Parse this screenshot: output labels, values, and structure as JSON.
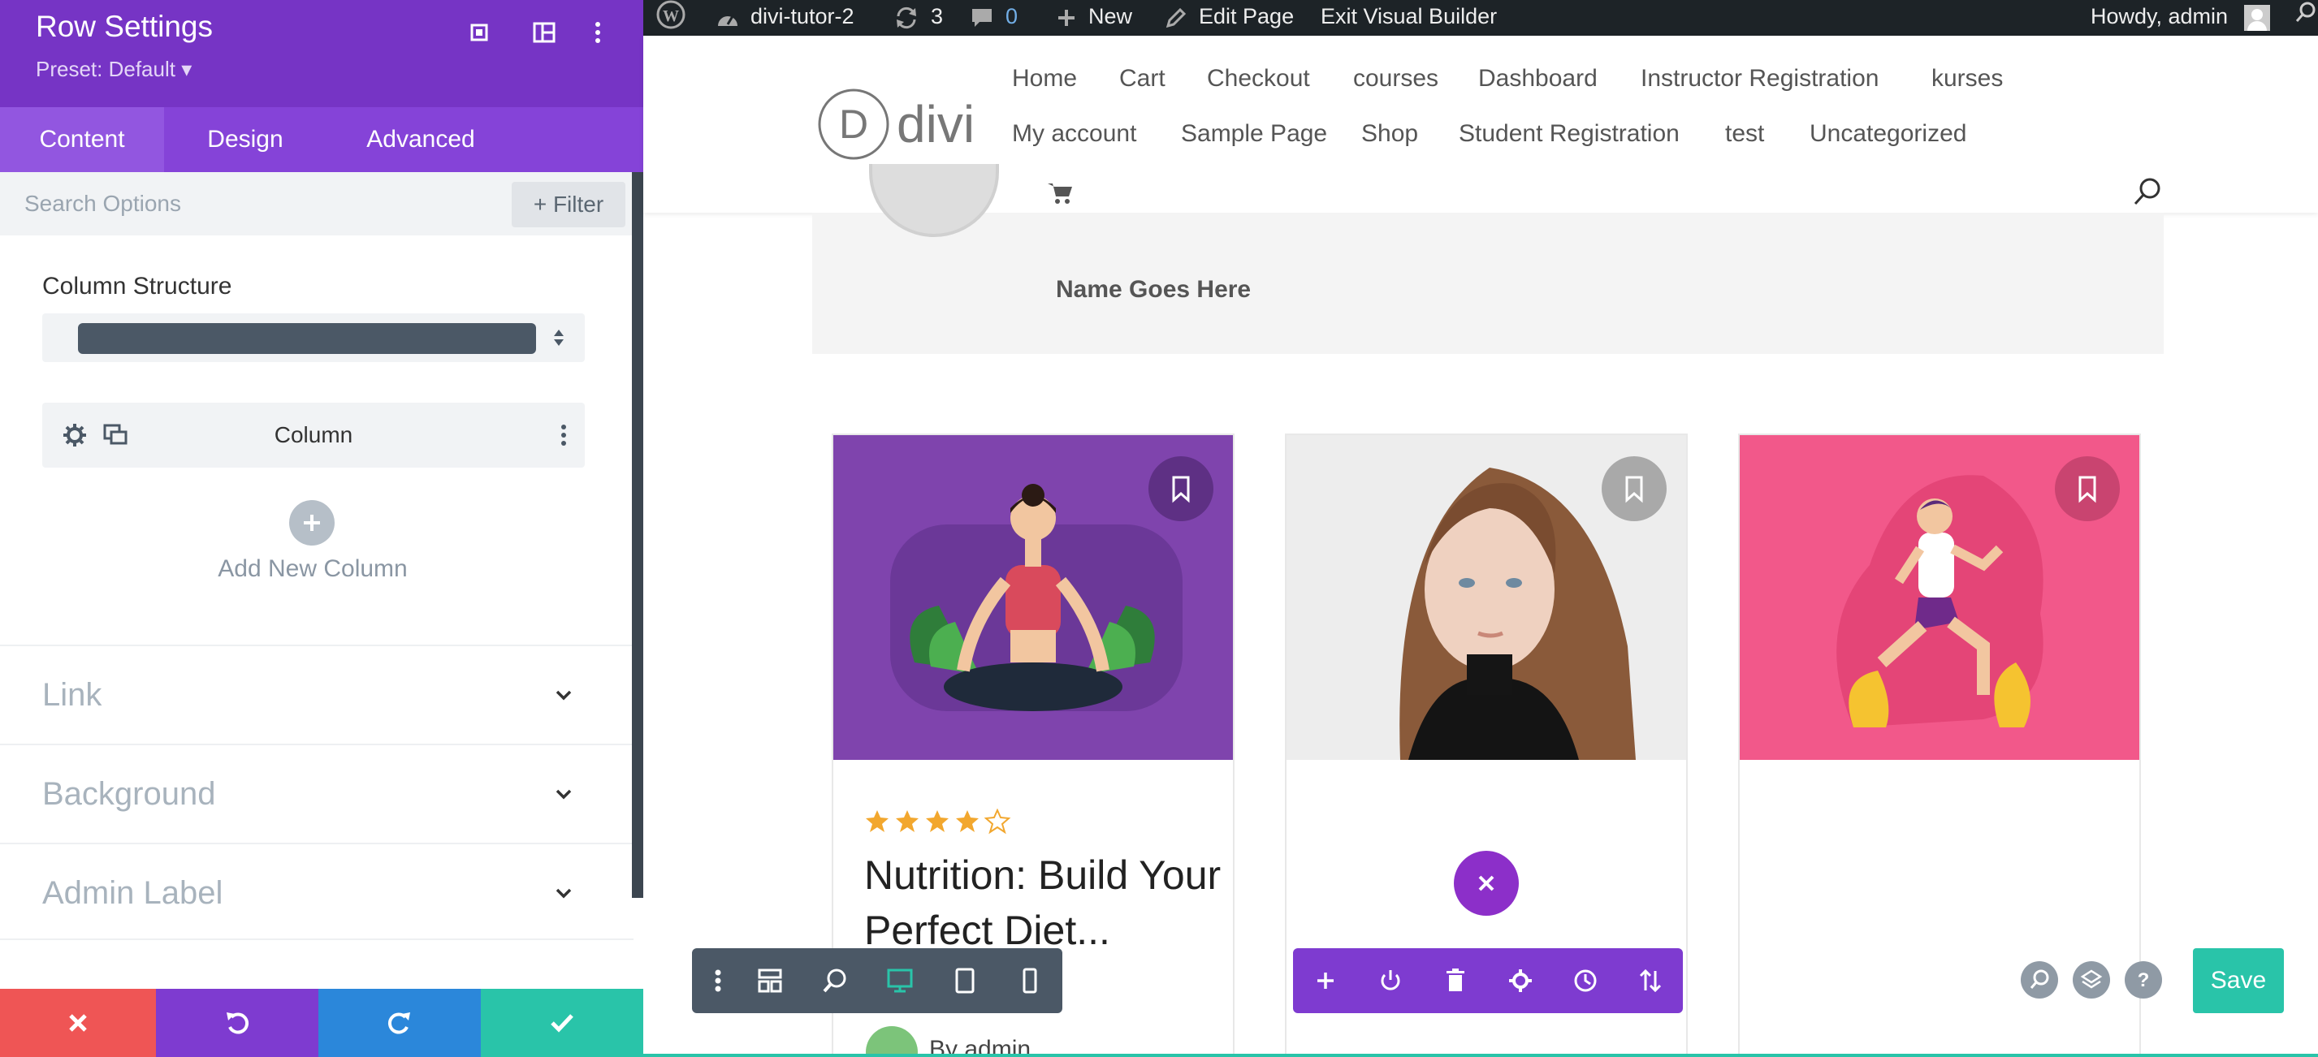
{
  "panel": {
    "title": "Row Settings",
    "preset": "Preset: Default",
    "tabs": [
      {
        "label": "Content"
      },
      {
        "label": "Design"
      },
      {
        "label": "Advanced"
      }
    ],
    "search_placeholder": "Search Options",
    "filter_label": "Filter",
    "column_structure_label": "Column Structure",
    "column_label": "Column",
    "add_column_label": "Add New Column",
    "toggles": [
      {
        "label": "Link"
      },
      {
        "label": "Background"
      },
      {
        "label": "Admin Label"
      }
    ]
  },
  "adminbar": {
    "site_name": "divi-tutor-2",
    "updates_count": "3",
    "comments_count": "0",
    "new_label": "New",
    "edit_page_label": "Edit Page",
    "exit_label": "Exit Visual Builder",
    "howdy": "Howdy, admin"
  },
  "site": {
    "logo_text": "divi",
    "nav_row1": [
      "Home",
      "Cart",
      "Checkout",
      "courses",
      "Dashboard",
      "Instructor Registration",
      "kurses"
    ],
    "nav_row2": [
      "My account",
      "Sample Page",
      "Shop",
      "Student Registration",
      "test",
      "Uncategorized"
    ]
  },
  "content": {
    "name_text": "Name Goes Here",
    "course_title": "Nutrition: Build Your Perfect Diet...",
    "rating": "4 of 5",
    "author": "By admin"
  },
  "builder": {
    "save_label": "Save"
  },
  "colors": {
    "panel_purple": "#7634c5",
    "builder_green": "#29c4a9",
    "card_purple": "#7f44ad",
    "card_pink": "#f2588a"
  }
}
